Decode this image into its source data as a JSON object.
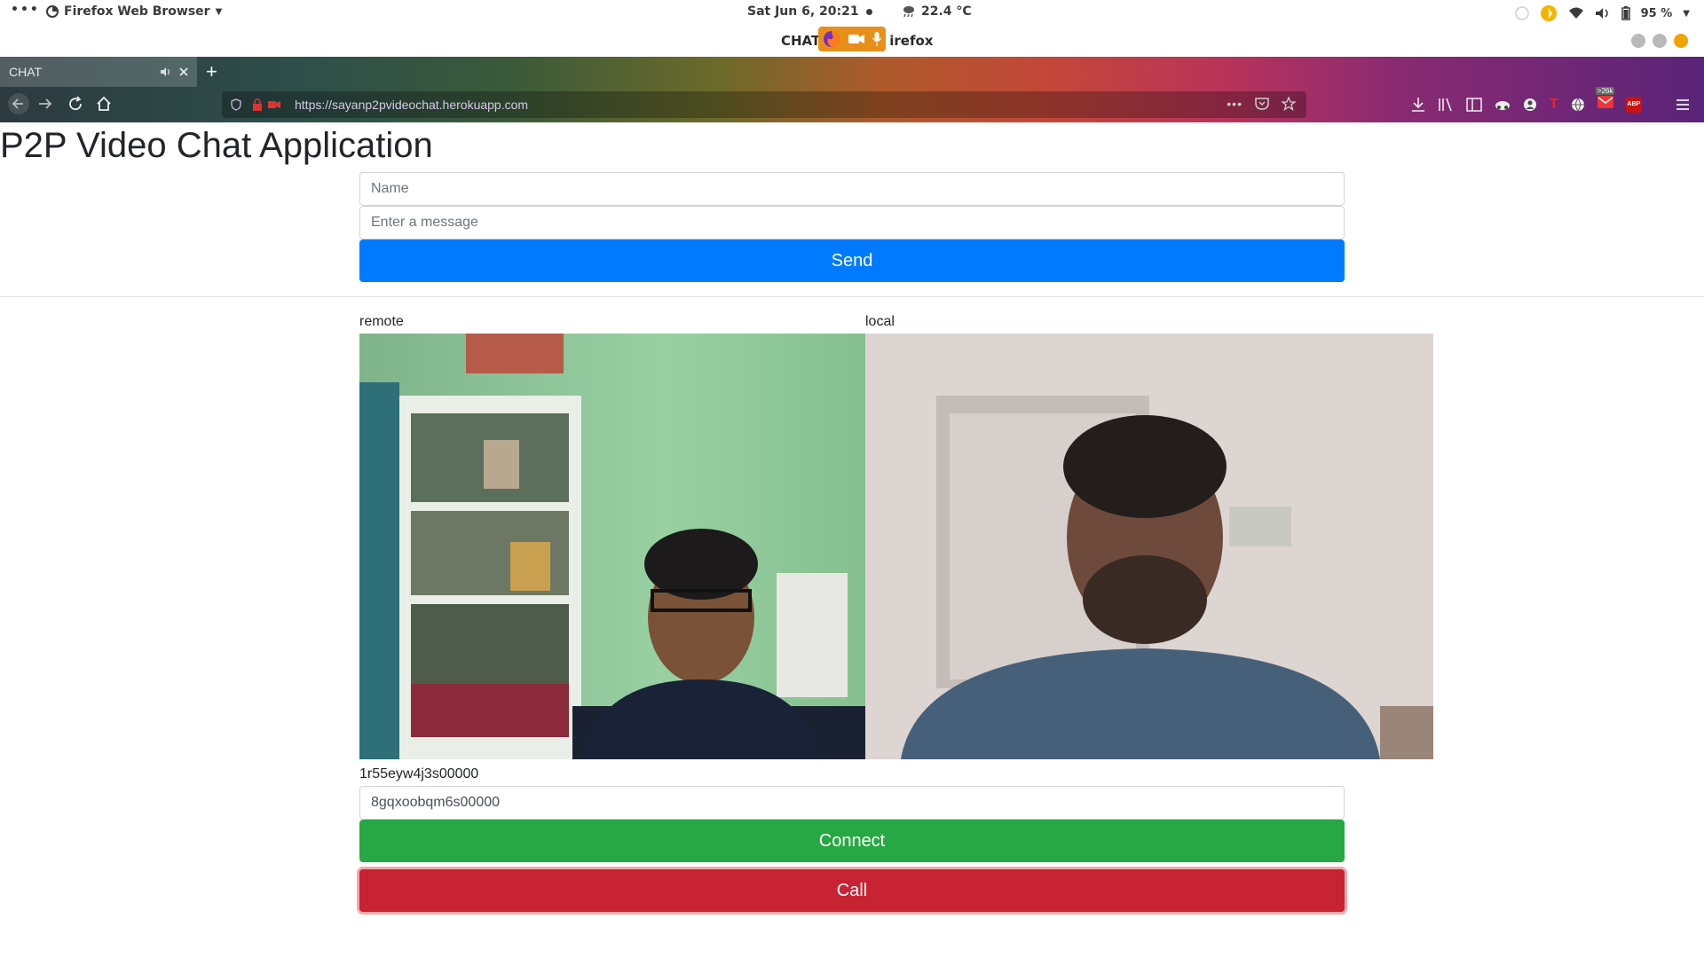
{
  "system_bar": {
    "activities": "•••",
    "app_name": "Firefox Web Browser",
    "clock": "Sat Jun  6, 20:21",
    "weather": "22.4 °C",
    "battery": "95 %"
  },
  "window": {
    "title": "CHAT",
    "title_suffix": "irefox"
  },
  "tab": {
    "label": "CHAT"
  },
  "urlbar": {
    "url": "https://sayanp2pvideochat.herokuapp.com"
  },
  "toolbar": {
    "badge_count": ">26k",
    "abp_label": "ABP"
  },
  "page": {
    "title": "P2P Video Chat Application",
    "chat_form": {
      "name_placeholder": "Name",
      "message_placeholder": "Enter a message",
      "send_label": "Send"
    },
    "videos": {
      "remote_label": "remote",
      "local_label": "local"
    },
    "connection": {
      "my_peer_id": "1r55eyw4j3s00000",
      "remote_peer_id_value": "8gqxoobqm6s00000",
      "connect_label": "Connect",
      "call_label": "Call"
    }
  },
  "colors": {
    "primary": "#007bff",
    "success": "#28a745",
    "danger": "#c82333",
    "indicator": "#e88f1a"
  }
}
